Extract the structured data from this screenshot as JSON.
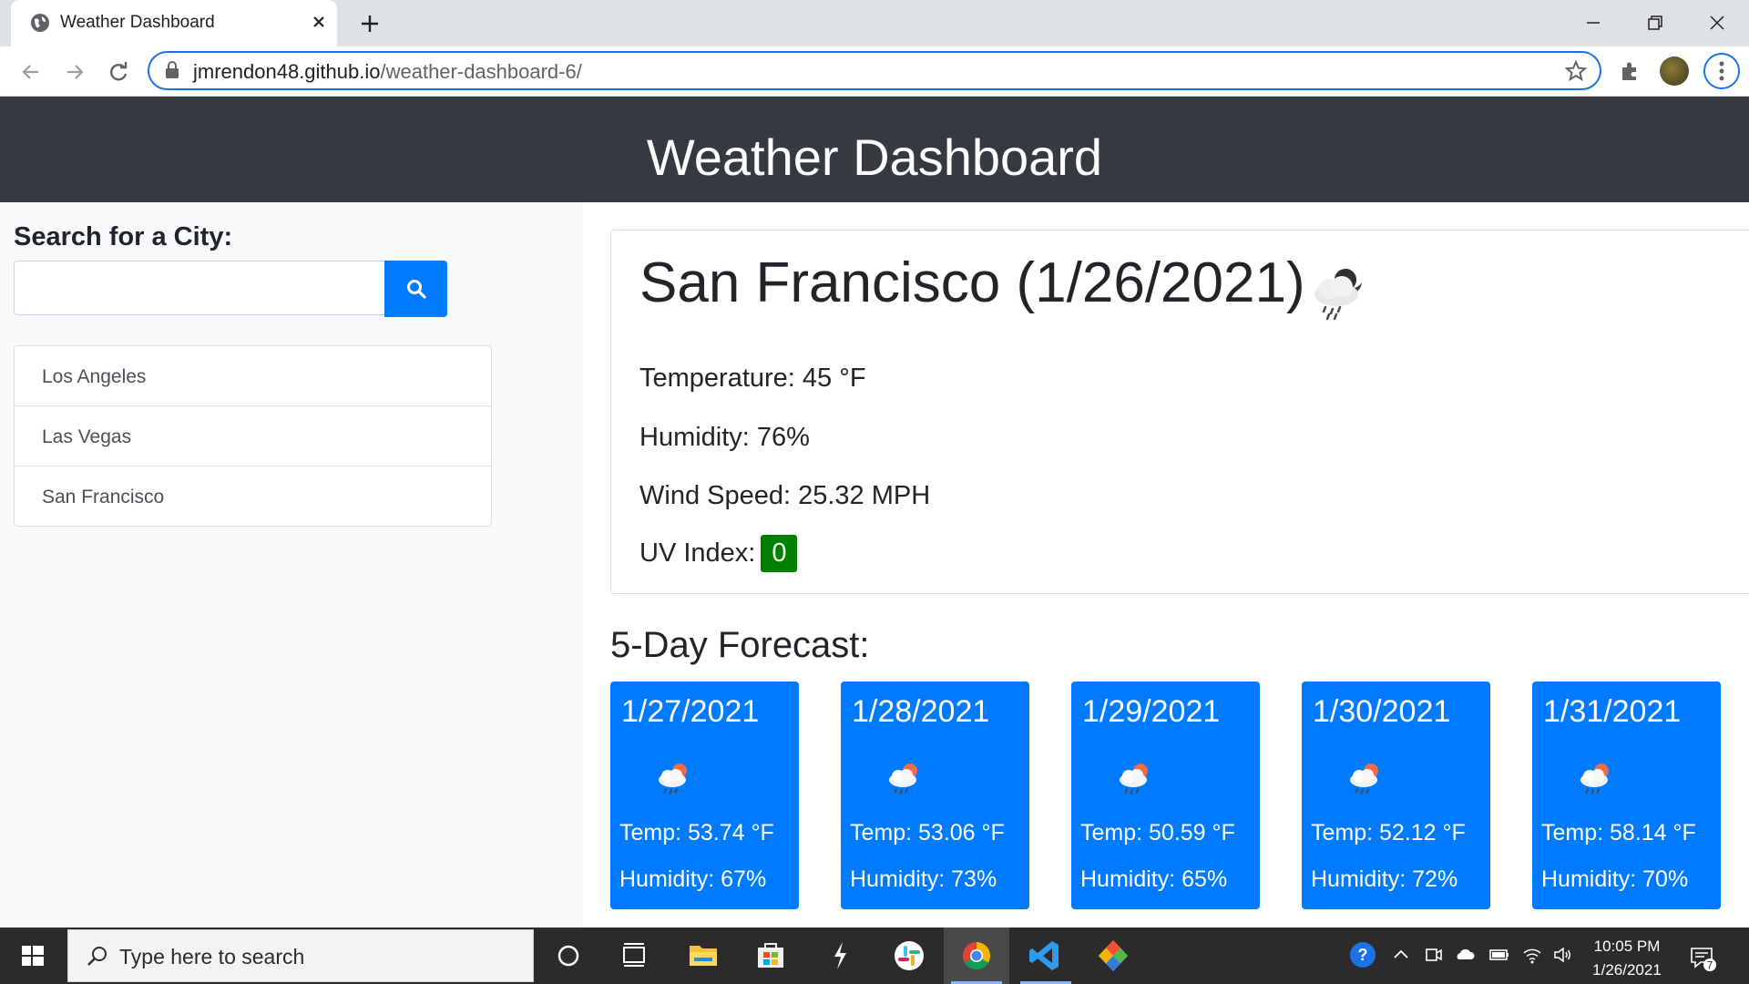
{
  "browser": {
    "tab_title": "Weather Dashboard",
    "url_host": "jmrendon48.github.io",
    "url_path": "/weather-dashboard-6/"
  },
  "header": {
    "title": "Weather Dashboard"
  },
  "sidebar": {
    "search_label": "Search for a City:",
    "search_value": "",
    "cities": [
      "Los Angeles",
      "Las Vegas",
      "San Francisco"
    ]
  },
  "current": {
    "title": "San Francisco (1/26/2021)",
    "icon": "rain-cloud-night-icon",
    "temperature": "Temperature: 45 °F",
    "humidity": "Humidity: 76%",
    "wind": "Wind Speed: 25.32 MPH",
    "uv_label": "UV Index:",
    "uv_value": "0",
    "uv_color": "#008000"
  },
  "forecast": {
    "title": "5-Day Forecast:",
    "days": [
      {
        "date": "1/27/2021",
        "icon": "rain-cloud-sun-icon",
        "temp": "Temp: 53.74 °F",
        "humidity": "Humidity: 67%"
      },
      {
        "date": "1/28/2021",
        "icon": "rain-cloud-sun-icon",
        "temp": "Temp: 53.06 °F",
        "humidity": "Humidity: 73%"
      },
      {
        "date": "1/29/2021",
        "icon": "rain-cloud-sun-icon",
        "temp": "Temp: 50.59 °F",
        "humidity": "Humidity: 65%"
      },
      {
        "date": "1/30/2021",
        "icon": "rain-cloud-sun-icon",
        "temp": "Temp: 52.12 °F",
        "humidity": "Humidity: 72%"
      },
      {
        "date": "1/31/2021",
        "icon": "rain-cloud-sun-icon",
        "temp": "Temp: 58.14 °F",
        "humidity": "Humidity: 70%"
      }
    ]
  },
  "taskbar": {
    "search_placeholder": "Type here to search",
    "time": "10:05 PM",
    "date": "1/26/2021",
    "notification_count": "7"
  },
  "colors": {
    "header_bg": "#343a40",
    "accent": "#007bff",
    "uv_low": "#008000"
  }
}
